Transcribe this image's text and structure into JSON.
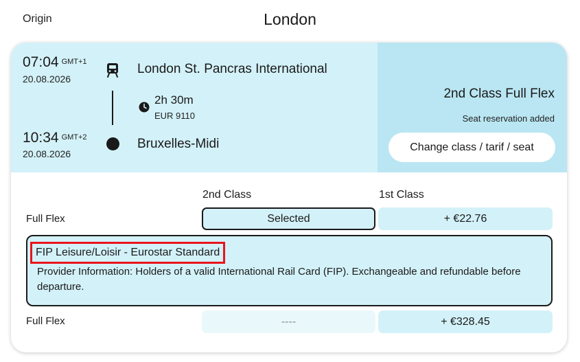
{
  "header": {
    "origin_label": "Origin",
    "origin_city": "London"
  },
  "journey": {
    "departure": {
      "time": "07:04",
      "tz": "GMT+1",
      "date": "20.08.2026",
      "station": "London St. Pancras International"
    },
    "duration": "2h 30m",
    "train_number": "EUR 9110",
    "arrival": {
      "time": "10:34",
      "tz": "GMT+2",
      "date": "20.08.2026",
      "station": "Bruxelles-Midi"
    },
    "selected_class": "2nd Class Full Flex",
    "seat_note": "Seat reservation added",
    "change_button": "Change class / tarif / seat"
  },
  "fares": {
    "columns": [
      "2nd Class",
      "1st Class"
    ],
    "rows": [
      {
        "label": "Full Flex",
        "second": "Selected",
        "first": "+ €22.76"
      },
      {
        "label": "Full Flex",
        "second": "----",
        "first": "+ €328.45"
      }
    ],
    "info": {
      "title": "FIP Leisure/Loisir - Eurostar Standard",
      "text": "Provider Information: Holders of a valid International Rail Card (FIP). Exchangeable and refundable before departure."
    }
  },
  "colors": {
    "panel": "#d3f1f8",
    "panel_dark": "#b9e6f2",
    "highlight": "#e8141c"
  }
}
